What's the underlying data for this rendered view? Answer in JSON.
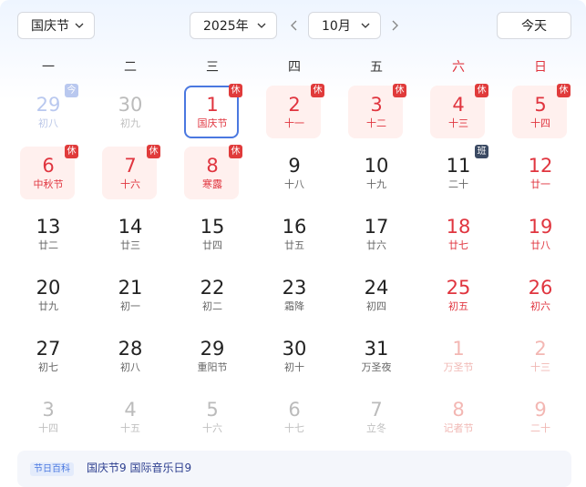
{
  "toolbar": {
    "holiday_select": "国庆节",
    "year_select": "2025年",
    "month_select": "10月",
    "today_label": "今天"
  },
  "weekdays": [
    "一",
    "二",
    "三",
    "四",
    "五",
    "六",
    "日"
  ],
  "days": [
    {
      "num": "29",
      "lunar": "初八",
      "style": "dimblue",
      "badge": "今",
      "badge_type": "today"
    },
    {
      "num": "30",
      "lunar": "初九",
      "style": "dim"
    },
    {
      "num": "1",
      "lunar": "国庆节",
      "style": "red",
      "box": "selected",
      "badge": "休",
      "badge_type": "rest"
    },
    {
      "num": "2",
      "lunar": "十一",
      "style": "red",
      "box": "rest",
      "badge": "休",
      "badge_type": "rest"
    },
    {
      "num": "3",
      "lunar": "十二",
      "style": "red",
      "box": "rest",
      "badge": "休",
      "badge_type": "rest"
    },
    {
      "num": "4",
      "lunar": "十三",
      "style": "red",
      "box": "rest",
      "badge": "休",
      "badge_type": "rest"
    },
    {
      "num": "5",
      "lunar": "十四",
      "style": "red",
      "box": "rest",
      "badge": "休",
      "badge_type": "rest"
    },
    {
      "num": "6",
      "lunar": "中秋节",
      "style": "red",
      "box": "rest",
      "badge": "休",
      "badge_type": "rest"
    },
    {
      "num": "7",
      "lunar": "十六",
      "style": "red",
      "box": "rest",
      "badge": "休",
      "badge_type": "rest"
    },
    {
      "num": "8",
      "lunar": "寒露",
      "style": "red",
      "box": "rest",
      "badge": "休",
      "badge_type": "rest"
    },
    {
      "num": "9",
      "lunar": "十八",
      "style": "normal"
    },
    {
      "num": "10",
      "lunar": "十九",
      "style": "normal"
    },
    {
      "num": "11",
      "lunar": "二十",
      "style": "normal",
      "badge": "班",
      "badge_type": "work"
    },
    {
      "num": "12",
      "lunar": "廿一",
      "style": "red"
    },
    {
      "num": "13",
      "lunar": "廿二",
      "style": "normal"
    },
    {
      "num": "14",
      "lunar": "廿三",
      "style": "normal"
    },
    {
      "num": "15",
      "lunar": "廿四",
      "style": "normal"
    },
    {
      "num": "16",
      "lunar": "廿五",
      "style": "normal"
    },
    {
      "num": "17",
      "lunar": "廿六",
      "style": "normal"
    },
    {
      "num": "18",
      "lunar": "廿七",
      "style": "red"
    },
    {
      "num": "19",
      "lunar": "廿八",
      "style": "red"
    },
    {
      "num": "20",
      "lunar": "廿九",
      "style": "normal"
    },
    {
      "num": "21",
      "lunar": "初一",
      "style": "normal"
    },
    {
      "num": "22",
      "lunar": "初二",
      "style": "normal"
    },
    {
      "num": "23",
      "lunar": "霜降",
      "style": "normal"
    },
    {
      "num": "24",
      "lunar": "初四",
      "style": "normal"
    },
    {
      "num": "25",
      "lunar": "初五",
      "style": "red"
    },
    {
      "num": "26",
      "lunar": "初六",
      "style": "red"
    },
    {
      "num": "27",
      "lunar": "初七",
      "style": "normal"
    },
    {
      "num": "28",
      "lunar": "初八",
      "style": "normal"
    },
    {
      "num": "29",
      "lunar": "重阳节",
      "style": "normal"
    },
    {
      "num": "30",
      "lunar": "初十",
      "style": "normal"
    },
    {
      "num": "31",
      "lunar": "万圣夜",
      "style": "normal"
    },
    {
      "num": "1",
      "lunar": "万圣节",
      "style": "dimred"
    },
    {
      "num": "2",
      "lunar": "十三",
      "style": "dimred"
    },
    {
      "num": "3",
      "lunar": "十四",
      "style": "dim"
    },
    {
      "num": "4",
      "lunar": "十五",
      "style": "dim"
    },
    {
      "num": "5",
      "lunar": "十六",
      "style": "dim"
    },
    {
      "num": "6",
      "lunar": "十七",
      "style": "dim"
    },
    {
      "num": "7",
      "lunar": "立冬",
      "style": "dim"
    },
    {
      "num": "8",
      "lunar": "记者节",
      "style": "dimred"
    },
    {
      "num": "9",
      "lunar": "二十",
      "style": "dimred"
    }
  ],
  "info_bar": {
    "tag": "节日百科",
    "text": "国庆节9 国际音乐日9"
  },
  "colors": {
    "accent": "#4a78e0",
    "holiday_red": "#e0353f",
    "rest_bg": "#fff0ee",
    "work_badge": "#3b4a63"
  }
}
